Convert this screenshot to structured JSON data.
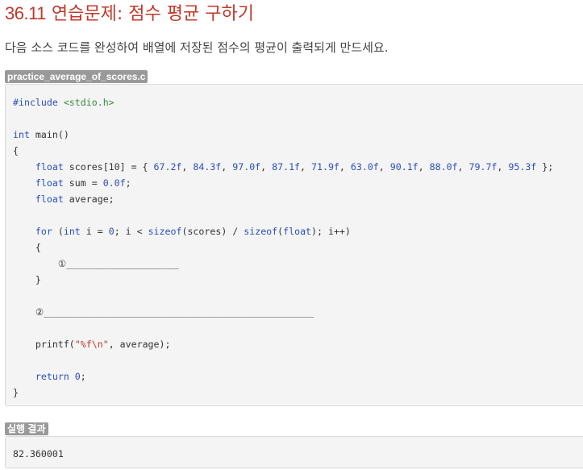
{
  "header": {
    "section_number": "36.11",
    "title": "연습문제: 점수 평균 구하기"
  },
  "instructions": "다음 소스 코드를 완성하여 배열에 저장된 점수의 평균이 출력되게 만드세요.",
  "source": {
    "filename": "practice_average_of_scores.c",
    "line_include_kw": "#include",
    "line_include_hdr": "<stdio.h>",
    "kw_int": "int",
    "main_sig": " main()",
    "open_brace": "{",
    "close_brace": "}",
    "kw_float": "float",
    "scores_decl_head": " scores[10] = { ",
    "scores_values": [
      "67.2f",
      "84.3f",
      "97.0f",
      "87.1f",
      "71.9f",
      "63.0f",
      "90.1f",
      "88.0f",
      "79.7f",
      "95.3f"
    ],
    "scores_decl_tail": " };",
    "sum_decl_head": " sum = ",
    "sum_init": "0.0f",
    "semicolon": ";",
    "average_decl": " average;",
    "kw_for": "for",
    "for_paren_open": " (",
    "for_i_assign": " i = ",
    "zero": "0",
    "for_cond_a": "; i < ",
    "kw_sizeof": "sizeof",
    "sizeof_arg_scores": "(scores) / ",
    "sizeof_arg_float_open": "(",
    "for_tail": "); i++)",
    "blank_1_label": "①",
    "blank_1_line": "____________________",
    "blank_2_label": "②",
    "blank_2_line": "________________________________________________",
    "printf_call": "printf(",
    "printf_fmt": "\"%f\\n\"",
    "printf_args": ", average);",
    "kw_return": "return",
    "return_val_sp": " ",
    "return_tail": ";"
  },
  "output": {
    "label": "실행 결과",
    "value": "82.360001"
  },
  "colors": {
    "title": "#c0392b",
    "keyword": "#2a4fbf",
    "string": "#c0392b",
    "include_header": "#3a8a3a",
    "label_bg": "#999999",
    "code_bg": "#f4f4f4"
  }
}
